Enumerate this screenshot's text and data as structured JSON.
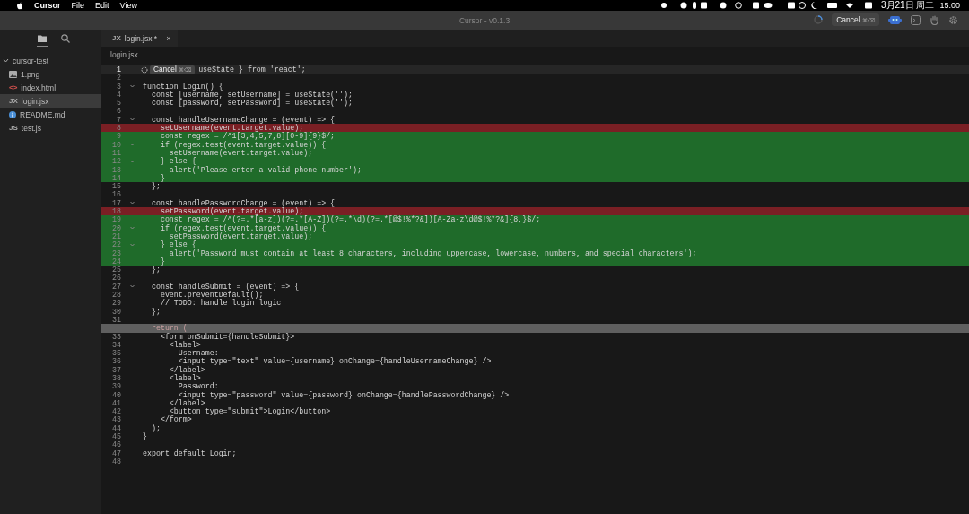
{
  "menu_bar": {
    "app": "Cursor",
    "items": [
      "File",
      "Edit",
      "View"
    ],
    "date": "3月21日 周二",
    "time": "15:00"
  },
  "window": {
    "title": "Cursor - v0.1.3",
    "cancel": {
      "label": "Cancel",
      "shortcut": "⌘⌫"
    }
  },
  "sidebar": {
    "views": [
      {
        "kind": "files",
        "selected": true
      },
      {
        "kind": "search",
        "selected": false
      }
    ],
    "tree": [
      {
        "label": "cursor-test",
        "expanded": true,
        "selected": false,
        "children": [
          {
            "label": "1.png",
            "kind": "image",
            "selected": false
          },
          {
            "label": "index.html",
            "kind": "html",
            "badge": "<>",
            "selected": false
          },
          {
            "label": "login.jsx",
            "kind": "jsx",
            "badge": "JX",
            "selected": true
          },
          {
            "label": "README.md",
            "kind": "info",
            "selected": false
          },
          {
            "label": "test.js",
            "kind": "js",
            "badge": "JS",
            "selected": false
          }
        ]
      }
    ]
  },
  "tabs": [
    {
      "badge": "JX",
      "label": "login.jsx *",
      "close": "×",
      "selected": true
    }
  ],
  "breadcrumb": "login.jsx",
  "editor": {
    "lines": [
      {
        "n": "1",
        "code": "useState } from 'react';",
        "kind": "plain",
        "current": true,
        "fold": false,
        "tooltip": {
          "label": "Cancel",
          "shortcut": "⌘⌫"
        }
      },
      {
        "n": "2",
        "kind": "plain",
        "current": false,
        "fold": false
      },
      {
        "n": "3",
        "code": "function Login() {",
        "kind": "plain",
        "current": false,
        "fold": true
      },
      {
        "n": "4",
        "code": "  const [username, setUsername] = useState('');",
        "kind": "plain",
        "current": false,
        "fold": false
      },
      {
        "n": "5",
        "code": "  const [password, setPassword] = useState('');",
        "kind": "plain",
        "current": false,
        "fold": false
      },
      {
        "n": "6",
        "kind": "plain",
        "current": false,
        "fold": false
      },
      {
        "n": "7",
        "code": "  const handleUsernameChange = (event) => {",
        "kind": "plain",
        "current": false,
        "fold": true
      },
      {
        "n": "8",
        "code": "    setUsername(event.target.value);",
        "kind": "removed",
        "current": false,
        "fold": false
      },
      {
        "n": "9",
        "code": "    const regex = /^1[3,4,5,7,8][0-9]{9}$/;",
        "kind": "added",
        "current": false,
        "fold": false
      },
      {
        "n": "10",
        "code": "    if (regex.test(event.target.value)) {",
        "kind": "added",
        "current": false,
        "fold": true
      },
      {
        "n": "11",
        "code": "      setUsername(event.target.value);",
        "kind": "added",
        "current": false,
        "fold": false
      },
      {
        "n": "12",
        "code": "    } else {",
        "kind": "added",
        "current": false,
        "fold": true
      },
      {
        "n": "13",
        "code": "      alert('Please enter a valid phone number');",
        "kind": "added",
        "current": false,
        "fold": false
      },
      {
        "n": "14",
        "code": "    }",
        "kind": "added",
        "current": false,
        "fold": false
      },
      {
        "n": "15",
        "code": "  };",
        "kind": "plain",
        "current": false,
        "fold": false
      },
      {
        "n": "16",
        "kind": "plain",
        "current": false,
        "fold": false
      },
      {
        "n": "17",
        "code": "  const handlePasswordChange = (event) => {",
        "kind": "plain",
        "current": false,
        "fold": true
      },
      {
        "n": "18",
        "code": "    setPassword(event.target.value);",
        "kind": "removed",
        "current": false,
        "fold": false
      },
      {
        "n": "19",
        "code": "    const regex = /^(?=.*[a-z])(?=.*[A-Z])(?=.*\\d)(?=.*[@$!%*?&])[A-Za-z\\d@$!%*?&]{8,}$/;",
        "kind": "added",
        "current": false,
        "fold": false
      },
      {
        "n": "20",
        "code": "    if (regex.test(event.target.value)) {",
        "kind": "added",
        "current": false,
        "fold": true
      },
      {
        "n": "21",
        "code": "      setPassword(event.target.value);",
        "kind": "added",
        "current": false,
        "fold": false
      },
      {
        "n": "22",
        "code": "    } else {",
        "kind": "added",
        "current": false,
        "fold": true
      },
      {
        "n": "23",
        "code": "      alert('Password must contain at least 8 characters, including uppercase, lowercase, numbers, and special characters');",
        "kind": "added",
        "current": false,
        "fold": false
      },
      {
        "n": "24",
        "code": "    }",
        "kind": "added",
        "current": false,
        "fold": false
      },
      {
        "n": "25",
        "code": "  };",
        "kind": "plain",
        "current": false,
        "fold": false
      },
      {
        "n": "26",
        "kind": "plain",
        "current": false,
        "fold": false
      },
      {
        "n": "27",
        "code": "  const handleSubmit = (event) => {",
        "kind": "plain",
        "current": false,
        "fold": true
      },
      {
        "n": "28",
        "code": "    event.preventDefault();",
        "kind": "plain",
        "current": false,
        "fold": false
      },
      {
        "n": "29",
        "code": "    // TODO: handle login logic",
        "kind": "plain",
        "current": false,
        "fold": false
      },
      {
        "n": "30",
        "code": "  };",
        "kind": "plain",
        "current": false,
        "fold": false
      },
      {
        "n": "31",
        "kind": "plain",
        "current": false,
        "fold": false
      },
      {
        "code": "  return (",
        "kind": "pending",
        "current": false,
        "fold": false
      },
      {
        "n": "33",
        "code": "    <form onSubmit={handleSubmit}>",
        "kind": "plain",
        "current": false,
        "fold": false
      },
      {
        "n": "34",
        "code": "      <label>",
        "kind": "plain",
        "current": false,
        "fold": false
      },
      {
        "n": "35",
        "code": "        Username:",
        "kind": "plain",
        "current": false,
        "fold": false
      },
      {
        "n": "36",
        "code": "        <input type=\"text\" value={username} onChange={handleUsernameChange} />",
        "kind": "plain",
        "current": false,
        "fold": false
      },
      {
        "n": "37",
        "code": "      </label>",
        "kind": "plain",
        "current": false,
        "fold": false
      },
      {
        "n": "38",
        "code": "      <label>",
        "kind": "plain",
        "current": false,
        "fold": false
      },
      {
        "n": "39",
        "code": "        Password:",
        "kind": "plain",
        "current": false,
        "fold": false
      },
      {
        "n": "40",
        "code": "        <input type=\"password\" value={password} onChange={handlePasswordChange} />",
        "kind": "plain",
        "current": false,
        "fold": false
      },
      {
        "n": "41",
        "code": "      </label>",
        "kind": "plain",
        "current": false,
        "fold": false
      },
      {
        "n": "42",
        "code": "      <button type=\"submit\">Login</button>",
        "kind": "plain",
        "current": false,
        "fold": false
      },
      {
        "n": "43",
        "code": "    </form>",
        "kind": "plain",
        "current": false,
        "fold": false
      },
      {
        "n": "44",
        "code": "  );",
        "kind": "plain",
        "current": false,
        "fold": false
      },
      {
        "n": "45",
        "code": "}",
        "kind": "plain",
        "current": false,
        "fold": false
      },
      {
        "n": "46",
        "kind": "plain",
        "current": false,
        "fold": false
      },
      {
        "n": "47",
        "code": "export default Login;",
        "kind": "plain",
        "current": false,
        "fold": false
      },
      {
        "n": "48",
        "kind": "plain",
        "current": false,
        "fold": false
      }
    ]
  }
}
